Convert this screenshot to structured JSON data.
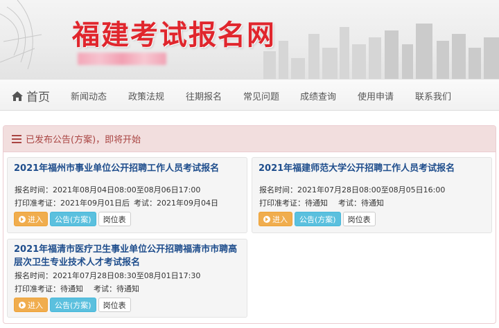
{
  "header": {
    "site_title": "福建考试报名网"
  },
  "nav": {
    "home": "首页",
    "items": [
      "新闻动态",
      "政策法规",
      "往期报名",
      "常见问题",
      "成绩查询",
      "使用申请",
      "联系我们"
    ]
  },
  "panel": {
    "title": "已发布公告(方案)，即将开始"
  },
  "buttons": {
    "enter": "进入",
    "notice": "公告(方案)",
    "positions": "岗位表"
  },
  "cards": [
    {
      "title": "2021年福州市事业单位公开招聘工作人员考试报名",
      "reg_time": "报名时间：2021年08月04日08:00至08月06日17:00",
      "print_ticket": "打印准考证：2021年09月01日后",
      "exam": "考试：2021年09月04日"
    },
    {
      "title": "2021年福建师范大学公开招聘工作人员考试报名",
      "reg_time": "报名时间：2021年07月28日08:00至08月05日16:00",
      "print_ticket": "打印准考证：待通知",
      "exam": "考试：待通知"
    },
    {
      "title_line1": "2021年福清市医疗卫生事业单位公开招聘福清市市聘高",
      "title_line2": "层次卫生专业技术人才考试报名",
      "reg_time": "报名时间：2021年07月28日08:30至08月01日17:30",
      "print_ticket": "打印准考证：待通知",
      "exam": "考试：待通知"
    }
  ]
}
